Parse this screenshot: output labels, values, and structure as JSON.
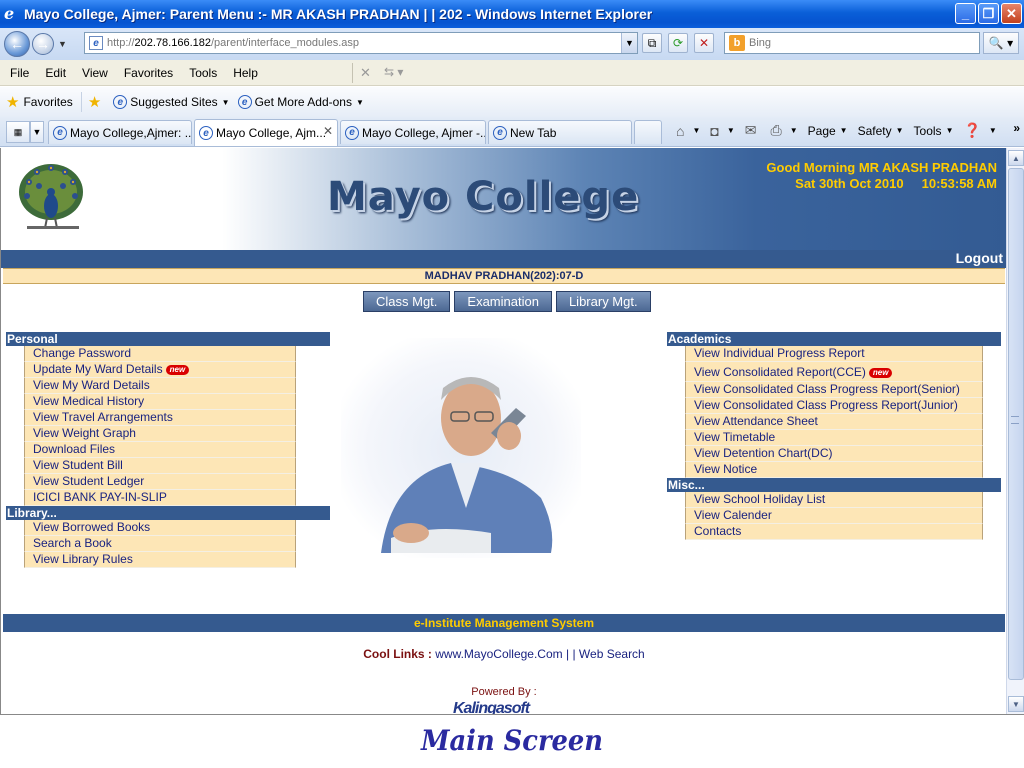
{
  "window": {
    "title": "Mayo College, Ajmer: Parent Menu :- MR AKASH PRADHAN | | 202 - Windows Internet Explorer"
  },
  "address": {
    "url_prefix": "http://",
    "url_host": "202.78.166.182",
    "url_path": "/parent/interface_modules.asp",
    "search_placeholder": "Bing"
  },
  "menubar": [
    "File",
    "Edit",
    "View",
    "Favorites",
    "Tools",
    "Help"
  ],
  "favorites": {
    "label": "Favorites",
    "suggested": "Suggested Sites",
    "addons": "Get More Add-ons"
  },
  "tabs": [
    {
      "label": "Mayo College,Ajmer: ..."
    },
    {
      "label": "Mayo College, Ajm..."
    },
    {
      "label": "Mayo College, Ajmer -..."
    },
    {
      "label": "New Tab"
    }
  ],
  "commandbar": {
    "page": "Page",
    "safety": "Safety",
    "tools": "Tools"
  },
  "page": {
    "college_name": "Mayo College",
    "greeting": "Good Morning MR AKASH PRADHAN",
    "date": "Sat 30th Oct 2010",
    "time": "10:53:58 AM",
    "logout": "Logout",
    "student": "MADHAV PRADHAN(202):07-D",
    "buttons": [
      "Class Mgt.",
      "Examination",
      "Library Mgt."
    ],
    "new_badge": "new",
    "personal": {
      "heading": "Personal",
      "items": [
        "Change Password",
        "Update My Ward Details",
        "View My Ward Details",
        "View Medical History",
        "View Travel Arrangements",
        "View Weight Graph",
        "Download Files",
        "View Student Bill",
        "View Student Ledger",
        "ICICI BANK PAY-IN-SLIP"
      ]
    },
    "library": {
      "heading": "Library...",
      "items": [
        "View Borrowed Books",
        "Search a Book",
        "View Library Rules"
      ]
    },
    "academics": {
      "heading": "Academics",
      "items": [
        "View Individual Progress Report",
        "View Consolidated Report(CCE)",
        "View Consolidated Class Progress Report(Senior)",
        "View Consolidated Class Progress Report(Junior)",
        "View Attendance Sheet",
        "View Timetable",
        "View Detention Chart(DC)",
        "View Notice"
      ]
    },
    "misc": {
      "heading": "Misc...",
      "items": [
        "View School Holiday List",
        "View Calender",
        "Contacts"
      ]
    },
    "footer_title": "e-Institute Management System",
    "cool_links_label": "Cool Links :",
    "cool_link_1": "www.MayoCollege.Com",
    "cool_sep": "| |",
    "cool_link_2": "Web Search",
    "powered_by": "Powered By :",
    "powered_logo": "Kalingasoft"
  },
  "caption": "Main Screen"
}
